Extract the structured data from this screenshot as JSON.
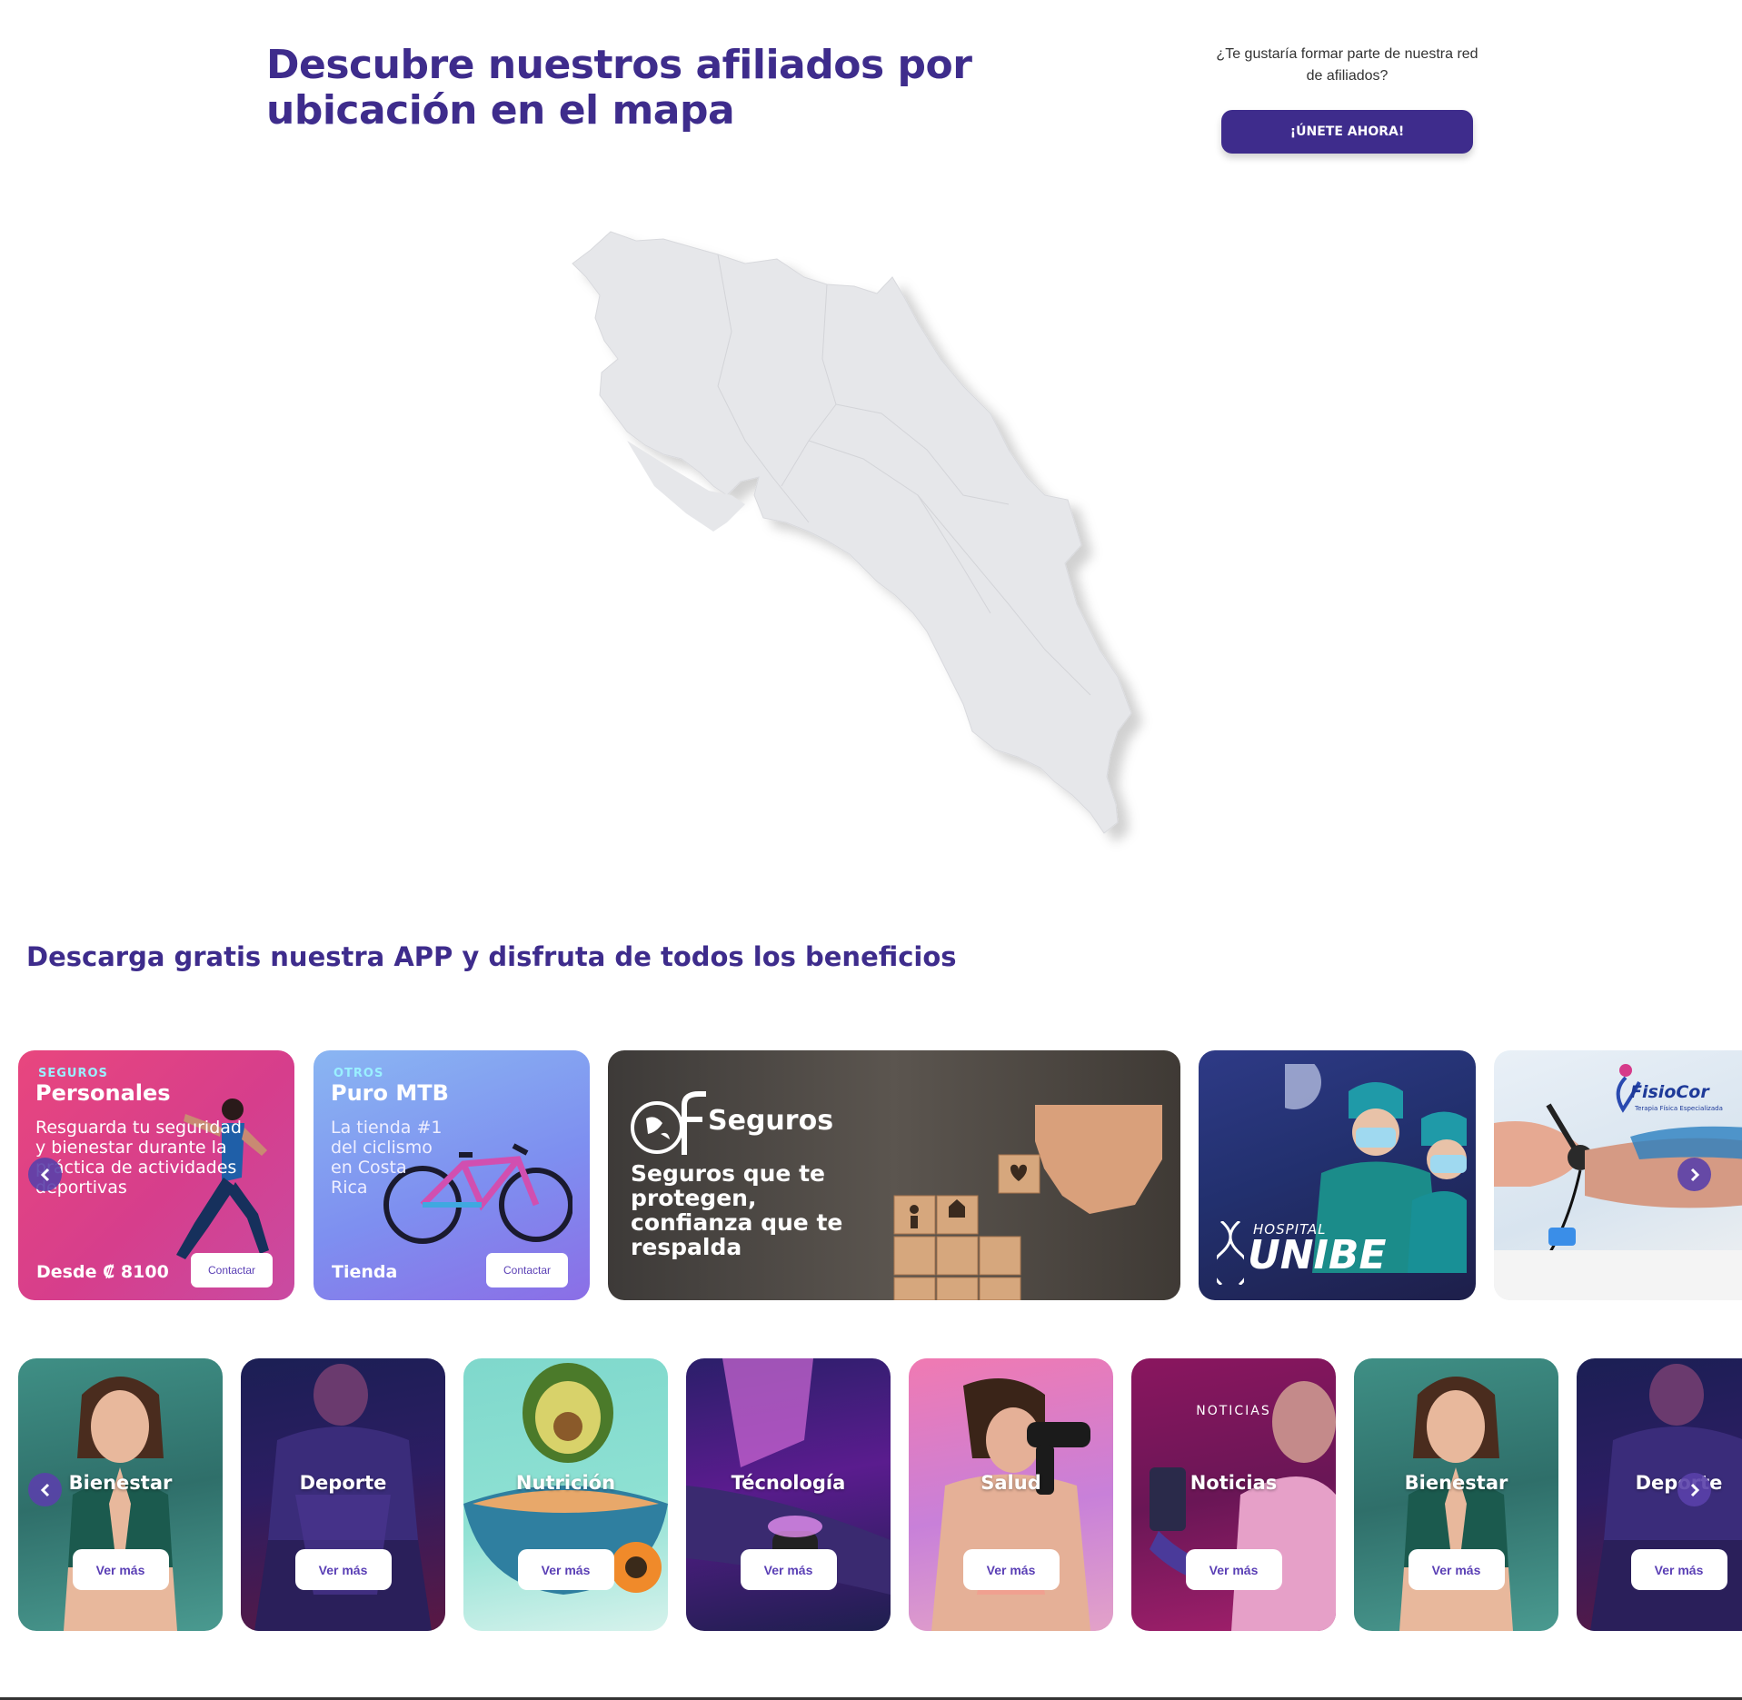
{
  "header": {
    "title": "Descubre nuestros afiliados por ubicación en el mapa",
    "join_question": "¿Te gustaría formar parte de nuestra red de afiliados?",
    "join_button": "¡ÚNETE AHORA!"
  },
  "map": {
    "icon": "costa-rica-map",
    "fill_color": "#e6e7ea"
  },
  "app_section": {
    "title": "Descarga gratis nuestra APP y disfruta de todos los beneficios"
  },
  "promo_cards": [
    {
      "category": "SEGUROS",
      "title": "Personales",
      "description": "Resguarda tu seguridad y bienestar durante la práctica de actividades deportivas",
      "bottom": "Desde ₡ 8100",
      "button": "Contactar"
    },
    {
      "category": "OTROS",
      "title": "Puro MTB",
      "description": "La tienda #1 del ciclismo en Costa Rica",
      "bottom": "Tienda",
      "button": "Contactar"
    },
    {
      "brand": "Seguros",
      "tagline": "Seguros que te protegen, confianza que te respalda"
    },
    {
      "brand_small": "HOSPITAL",
      "brand": "UNIBE"
    },
    {
      "brand": "FisioCor",
      "subtitle": "Terapia Física Especializada"
    }
  ],
  "categories": [
    {
      "label": "Bienestar",
      "button": "Ver más"
    },
    {
      "label": "Deporte",
      "button": "Ver más"
    },
    {
      "label": "Nutrición",
      "button": "Ver más"
    },
    {
      "label": "Técnología",
      "button": "Ver más"
    },
    {
      "label": "Salud",
      "button": "Ver más"
    },
    {
      "kicker": "NOTICIAS",
      "label": "Noticias",
      "button": "Ver más"
    },
    {
      "label": "Bienestar",
      "button": "Ver más"
    },
    {
      "label": "Deporte",
      "button": "Ver más"
    }
  ],
  "colors": {
    "brand": "#3e2c8c",
    "accent": "#5a3fb5"
  }
}
